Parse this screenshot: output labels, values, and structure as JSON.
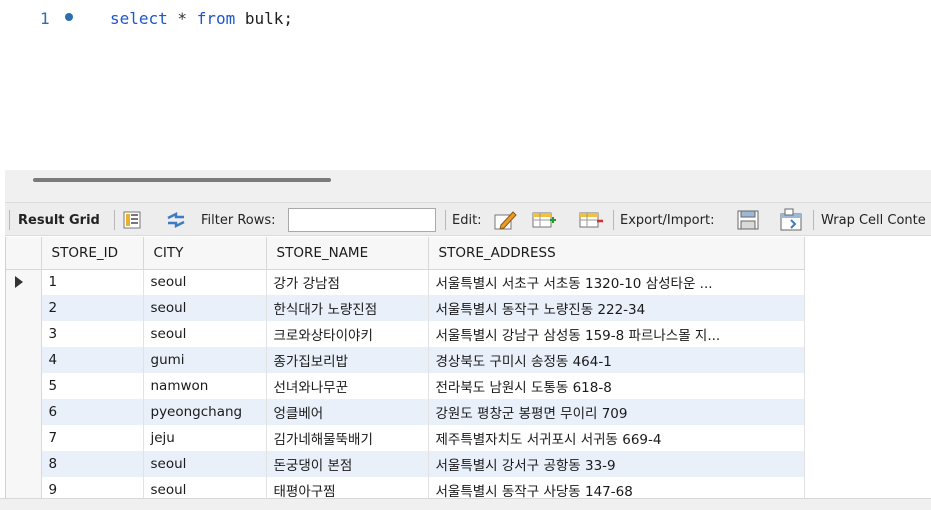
{
  "editor": {
    "line_number": "1",
    "sql_keyword_select": "select",
    "sql_star": " * ",
    "sql_keyword_from": "from",
    "sql_table": " bulk;"
  },
  "toolbar": {
    "result_grid": "Result Grid",
    "filter_rows": "Filter Rows:",
    "filter_value": "",
    "edit": "Edit:",
    "export_import": "Export/Import:",
    "wrap_cell": "Wrap Cell Conte"
  },
  "grid": {
    "columns": [
      "STORE_ID",
      "CITY",
      "STORE_NAME",
      "STORE_ADDRESS"
    ],
    "rows": [
      [
        "1",
        "seoul",
        "강가 강남점",
        "서울특별시 서초구 서초동 1320-10 삼성타운 ..."
      ],
      [
        "2",
        "seoul",
        "한식대가 노량진점",
        "서울특별시 동작구 노량진동 222-34"
      ],
      [
        "3",
        "seoul",
        "크로와상타이야키",
        "서울특별시 강남구 삼성동 159-8 파르나스몰 지..."
      ],
      [
        "4",
        "gumi",
        "종가집보리밥",
        "경상북도 구미시 송정동 464-1"
      ],
      [
        "5",
        "namwon",
        "선녀와나무꾼",
        "전라북도 남원시 도통동 618-8"
      ],
      [
        "6",
        "pyeongchang",
        "엉클베어",
        "강원도 평창군 봉평면 무이리 709"
      ],
      [
        "7",
        "jeju",
        "김가네해물뚝배기",
        "제주특별자치도 서귀포시 서귀동 669-4"
      ],
      [
        "8",
        "seoul",
        "돈궁댕이 본점",
        "서울특별시 강서구 공항동  33-9"
      ],
      [
        "9",
        "seoul",
        "태평아구찜",
        "서울특별시 동작구 사당동 147-68"
      ]
    ]
  },
  "colors": {
    "keyword": "#1f57c9",
    "row_highlight": "#eaf0fa",
    "toolbar_bg": "#ededed"
  }
}
